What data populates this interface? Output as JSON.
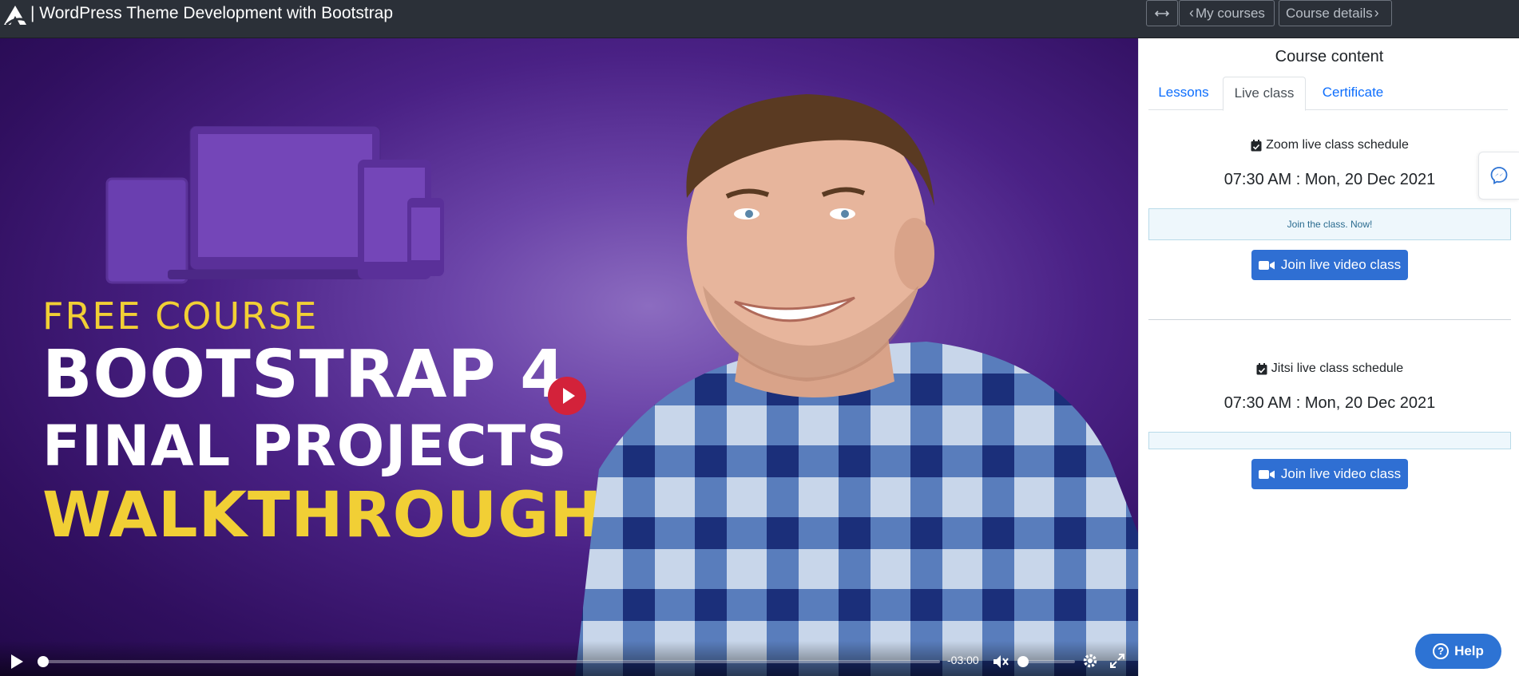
{
  "topbar": {
    "title": "| WordPress Theme Development with Bootstrap",
    "expand_icon": "arrows-horizontal-icon",
    "my_courses": "My courses",
    "course_details": "Course details"
  },
  "video": {
    "thumbnail": {
      "line1": "FREE COURSE",
      "line2": "BOOTSTRAP 4",
      "line3": "FINAL PROJECTS",
      "line4": "WALKTHROUGH"
    },
    "time_remaining": "-03:00",
    "progress_fraction": 0.0,
    "muted": true,
    "volume_fraction": 0.0
  },
  "sidebar": {
    "heading": "Course content",
    "tabs": [
      {
        "label": "Lessons",
        "active": false
      },
      {
        "label": "Live class",
        "active": true
      },
      {
        "label": "Certificate",
        "active": false
      }
    ],
    "schedules": [
      {
        "title": "Zoom live class schedule",
        "time": "07:30 AM : Mon, 20 Dec 2021",
        "alert": "Join the class. Now!",
        "button": "Join live video class"
      },
      {
        "title": "Jitsi live class schedule",
        "time": "07:30 AM : Mon, 20 Dec 2021",
        "alert": "",
        "button": "Join live video class"
      }
    ]
  },
  "help": {
    "label": "Help"
  },
  "colors": {
    "topbar": "#2b3038",
    "accent": "#2f6fd3",
    "link": "#0d6efd",
    "play_red": "#d3223a",
    "thumbnail_yellow": "#f1cf35"
  }
}
